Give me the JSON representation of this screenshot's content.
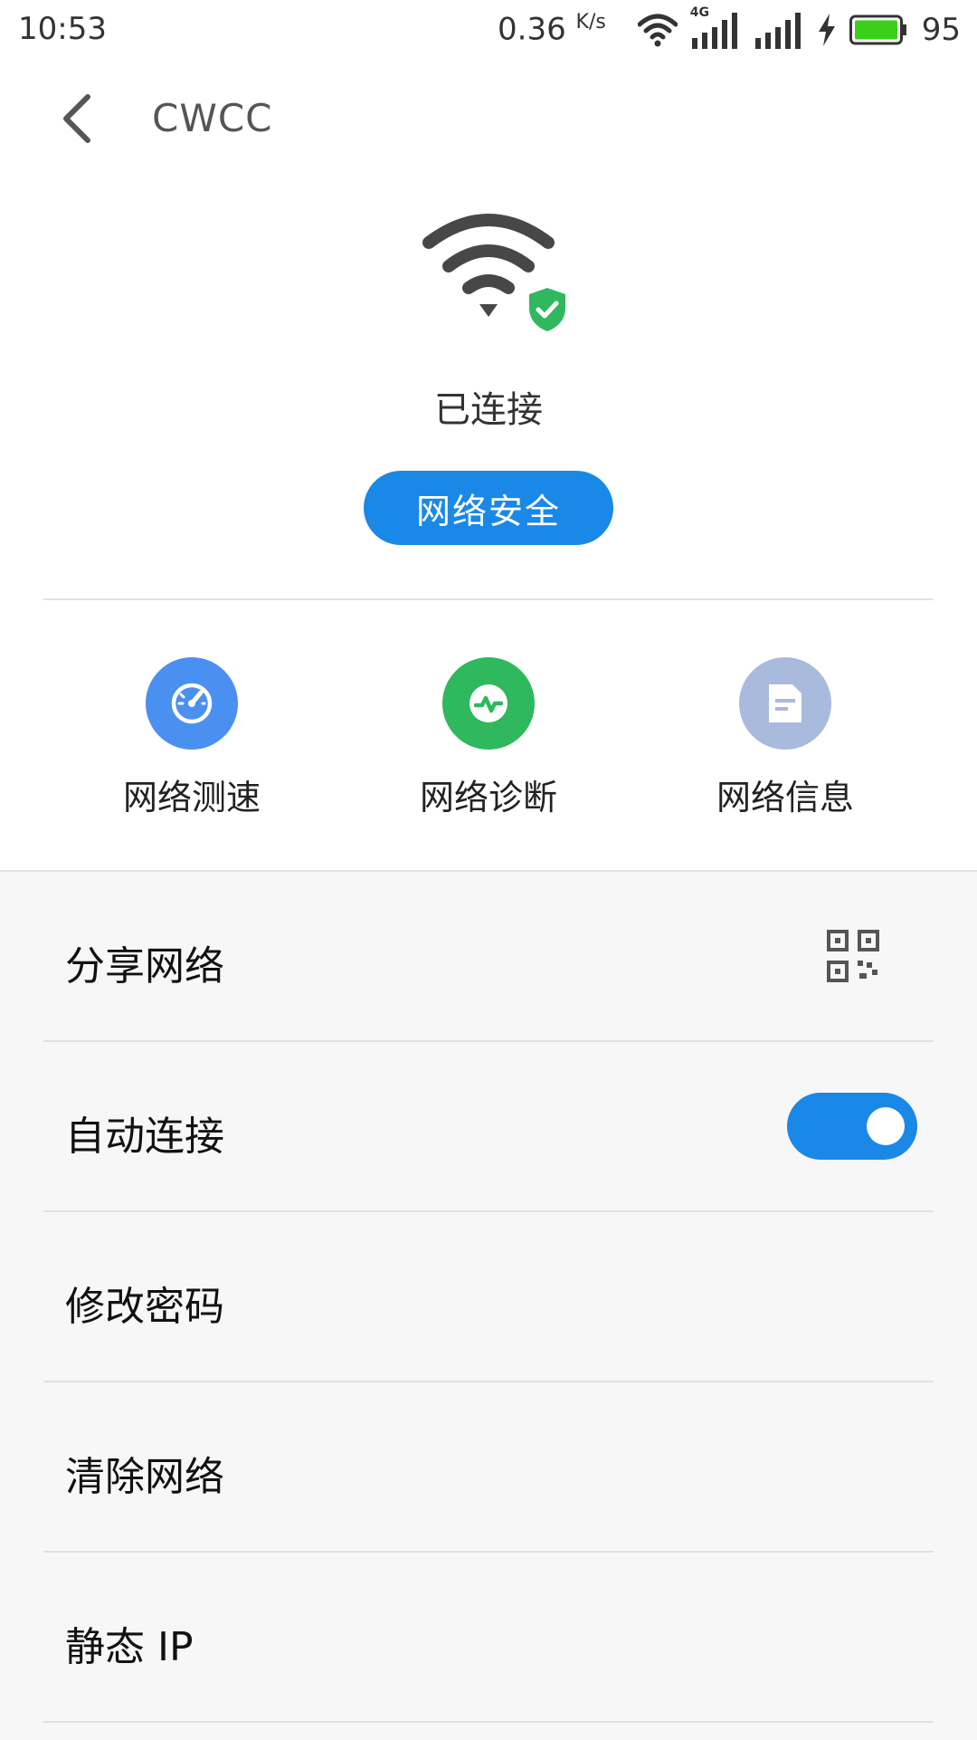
{
  "status_bar": {
    "time": "10:53",
    "speed": "0.36",
    "speed_unit": "K/s",
    "network_type": "4G",
    "battery_level": "95"
  },
  "header": {
    "title": "CWCC"
  },
  "hero": {
    "status": "已连接",
    "security_button": "网络安全"
  },
  "tools": [
    {
      "label": "网络测速",
      "icon": "speedometer-icon",
      "color": "#4a90f0"
    },
    {
      "label": "网络诊断",
      "icon": "pulse-icon",
      "color": "#2fb85d"
    },
    {
      "label": "网络信息",
      "icon": "document-icon",
      "color": "#a8bbdd"
    }
  ],
  "settings": [
    {
      "label": "分享网络",
      "control": "qr-code-icon"
    },
    {
      "label": "自动连接",
      "control": "toggle",
      "enabled": true
    },
    {
      "label": "修改密码"
    },
    {
      "label": "清除网络"
    },
    {
      "label": "静态 IP"
    }
  ],
  "colors": {
    "accent": "#1a88e6",
    "shield": "#2fb85d"
  }
}
